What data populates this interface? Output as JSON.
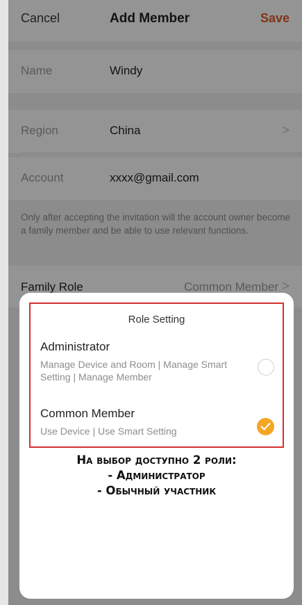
{
  "header": {
    "cancel_label": "Cancel",
    "title": "Add Member",
    "save_label": "Save",
    "save_color": "#e05a2b"
  },
  "form": {
    "name": {
      "label": "Name",
      "value": "Windy"
    },
    "region": {
      "label": "Region",
      "value": "China",
      "chevron": ">"
    },
    "account": {
      "label": "Account",
      "value": "xxxx@gmail.com"
    },
    "note": "Only after accepting the invitation will the account owner become a family member and be able to use relevant functions.",
    "family_role": {
      "label": "Family Role",
      "value": "Common Member",
      "chevron": ">"
    }
  },
  "role_sheet": {
    "title": "Role Setting",
    "options": [
      {
        "title": "Administrator",
        "description": "Manage Device and Room | Manage Smart Setting | Manage Member",
        "selected": false
      },
      {
        "title": "Common Member",
        "description": "Use Device | Use Smart Setting",
        "selected": true
      }
    ],
    "accent_color": "#f5a623",
    "highlight_color": "#d32f2f"
  },
  "annotation": {
    "lines": [
      "На выбор доступно 2 роли:",
      "- Администратор",
      "- Обычный участник"
    ]
  }
}
